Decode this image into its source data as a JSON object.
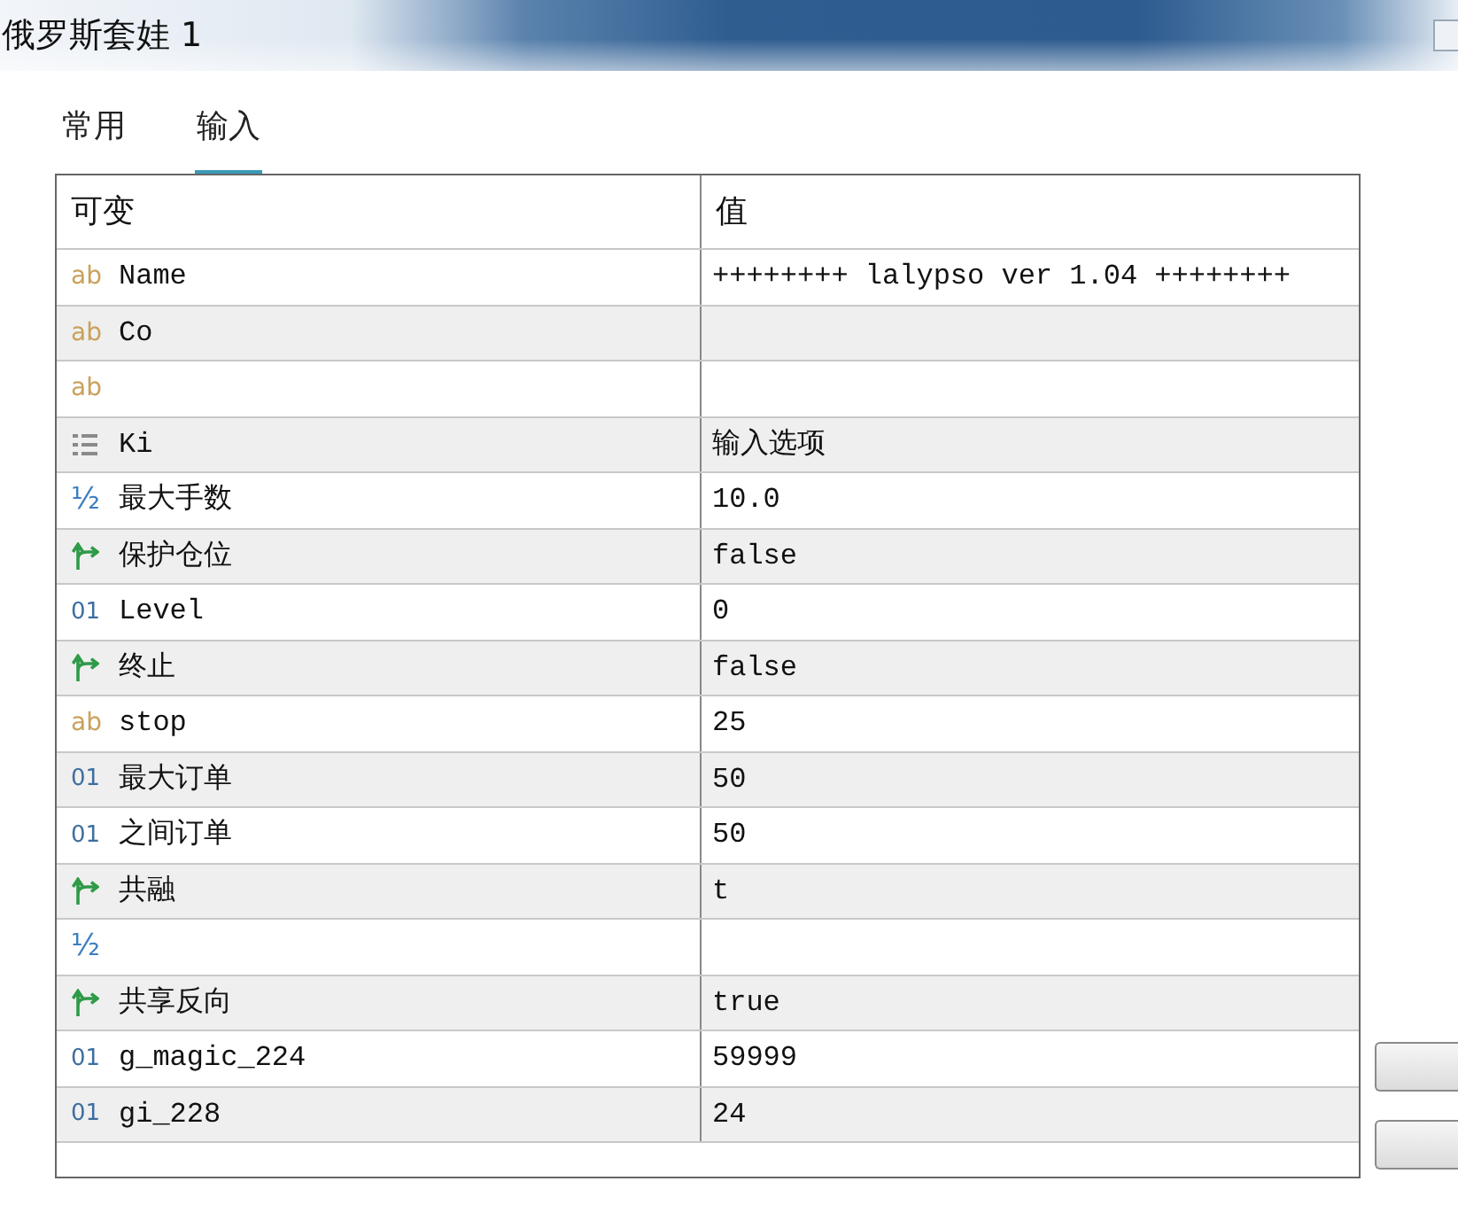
{
  "window": {
    "title": "俄罗斯套娃 1"
  },
  "tabs": [
    {
      "label": "常用",
      "selected": false
    },
    {
      "label": "输入",
      "selected": true
    }
  ],
  "table": {
    "columns": [
      "可变",
      "值"
    ],
    "rows": [
      {
        "kind": "string",
        "icon": "ab",
        "name": "Name",
        "value": "++++++++ lalypso ver 1.04 ++++++++"
      },
      {
        "kind": "string",
        "icon": "ab",
        "name": "Co"
      },
      {
        "kind": "string",
        "icon": "ab"
      },
      {
        "kind": "enum",
        "name": "Ki",
        "value": "输入选项"
      },
      {
        "kind": "double",
        "icon": "½",
        "name": "最大手数",
        "value": "10.0"
      },
      {
        "kind": "bool",
        "name": "保护仓位",
        "value": "false"
      },
      {
        "kind": "int",
        "icon": "01",
        "name": "Level",
        "value": "0"
      },
      {
        "kind": "bool",
        "name": "终止",
        "value": "false"
      },
      {
        "kind": "string",
        "icon": "ab",
        "name": "stop",
        "value": "25"
      },
      {
        "kind": "int",
        "icon": "01",
        "name": "最大订单",
        "value": "50"
      },
      {
        "kind": "int",
        "icon": "01",
        "name": "之间订单",
        "value": "50"
      },
      {
        "kind": "bool",
        "name": "共融",
        "value": "t"
      },
      {
        "kind": "double",
        "icon": "½"
      },
      {
        "kind": "bool",
        "name": "共享反向",
        "value": "true"
      },
      {
        "kind": "int",
        "icon": "01",
        "name": "g_magic_224",
        "value": "59999"
      },
      {
        "kind": "int",
        "icon": "01",
        "name": "gi_228",
        "value": "24"
      }
    ]
  }
}
